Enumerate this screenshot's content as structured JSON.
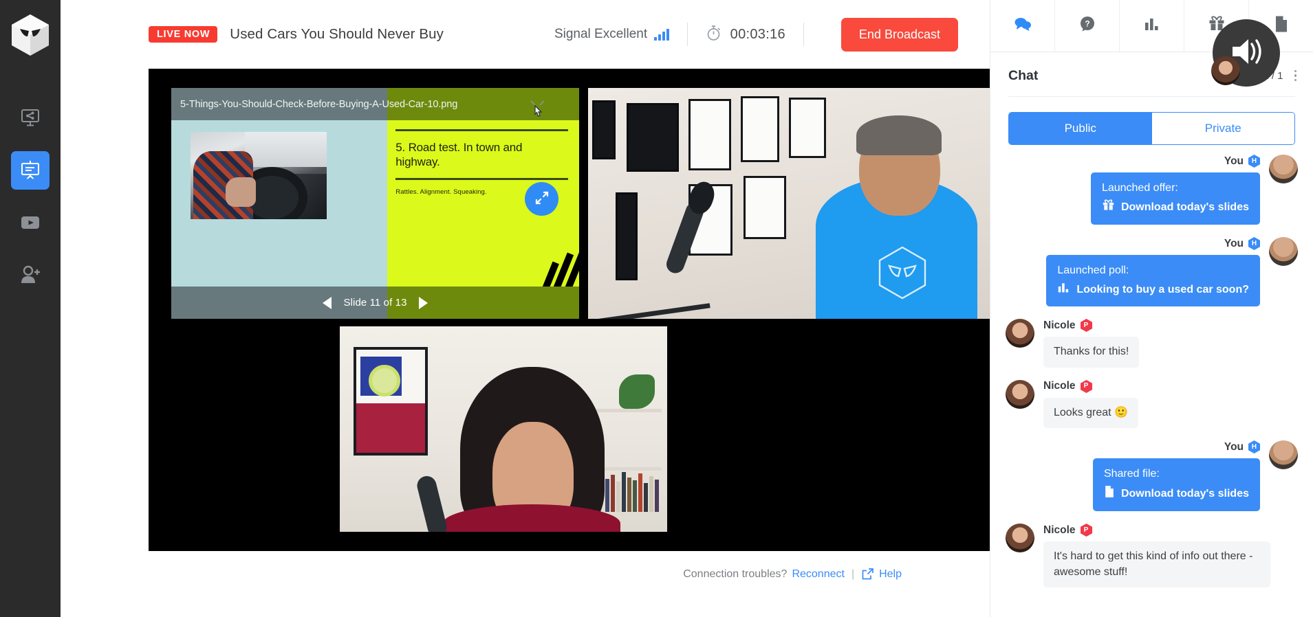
{
  "sidebar": {
    "logo": "webinarninja-mask-logo",
    "items": [
      {
        "name": "screen-share",
        "icon": "screen-share-icon",
        "active": false
      },
      {
        "name": "presentation",
        "icon": "presentation-icon",
        "active": true
      },
      {
        "name": "video",
        "icon": "video-play-icon",
        "active": false
      },
      {
        "name": "invite",
        "icon": "add-person-icon",
        "active": false
      }
    ]
  },
  "header": {
    "live_badge": "LIVE NOW",
    "title": "Used Cars You Should Never Buy",
    "signal_label": "Signal Excellent",
    "signal_icon": "signal-bars-icon",
    "timer_icon": "stopwatch-icon",
    "timer": "00:03:16",
    "end_button": "End Broadcast",
    "accent_red": "#f94a3d",
    "accent_blue": "#3b8cf6"
  },
  "slide": {
    "filename": "5-Things-You-Should-Check-Before-Buying-A-Used-Car-10.png",
    "heading": "5. Road test. In town and highway.",
    "subtext": "Rattles. Alignment. Squeaking.",
    "nav_label": "Slide 11 of 13",
    "prev_icon": "triangle-left-icon",
    "next_icon": "triangle-right-icon",
    "expand_icon": "expand-arrows-icon",
    "slide_bg_green": "#dbf91a",
    "slide_bg_teal": "#b7dbdd",
    "slide_bar_gray": "#67797d",
    "slide_bar_olive": "#6e8a0d"
  },
  "footer": {
    "connection_prompt": "Connection troubles?",
    "reconnect": "Reconnect",
    "separator": "|",
    "external_icon": "external-link-icon",
    "help": "Help"
  },
  "chat": {
    "tabs": [
      {
        "name": "chat",
        "icon": "chat-bubbles-icon",
        "active": true
      },
      {
        "name": "questions",
        "icon": "question-bubble-icon",
        "active": false
      },
      {
        "name": "polls",
        "icon": "bar-chart-icon",
        "active": false
      },
      {
        "name": "offers",
        "icon": "gift-icon",
        "active": false
      },
      {
        "name": "files",
        "icon": "document-icon",
        "active": false
      }
    ],
    "title": "Chat",
    "attendee_count": "1 / 1",
    "menu_icon": "kebab-menu-icon",
    "segments": {
      "public": "Public",
      "private": "Private",
      "selected": "Public"
    },
    "speaker_overlay_icon": "speaker-volume-icon",
    "messages": [
      {
        "direction": "out",
        "author": "You",
        "badge": "H",
        "badge_color": "#3b8cf6",
        "label": "Launched offer:",
        "action_icon": "gift-icon",
        "action_text": "Download today's slides",
        "avatar": "host-avatar"
      },
      {
        "direction": "out",
        "author": "You",
        "badge": "H",
        "badge_color": "#3b8cf6",
        "label": "Launched poll:",
        "action_icon": "bar-chart-icon",
        "action_text": "Looking to buy a used car soon?",
        "avatar": "host-avatar"
      },
      {
        "direction": "in",
        "author": "Nicole",
        "badge": "P",
        "badge_color": "#f0394a",
        "text": "Thanks for this!",
        "avatar": "guest-avatar"
      },
      {
        "direction": "in",
        "author": "Nicole",
        "badge": "P",
        "badge_color": "#f0394a",
        "text": "Looks great 🙂",
        "avatar": "guest-avatar"
      },
      {
        "direction": "out",
        "author": "You",
        "badge": "H",
        "badge_color": "#3b8cf6",
        "label": "Shared file:",
        "action_icon": "document-icon",
        "action_text": "Download today's slides",
        "avatar": "host-avatar"
      },
      {
        "direction": "in",
        "author": "Nicole",
        "badge": "P",
        "badge_color": "#f0394a",
        "text": "It's hard to get this kind of info out there - awesome stuff!",
        "avatar": "guest-avatar"
      }
    ]
  }
}
